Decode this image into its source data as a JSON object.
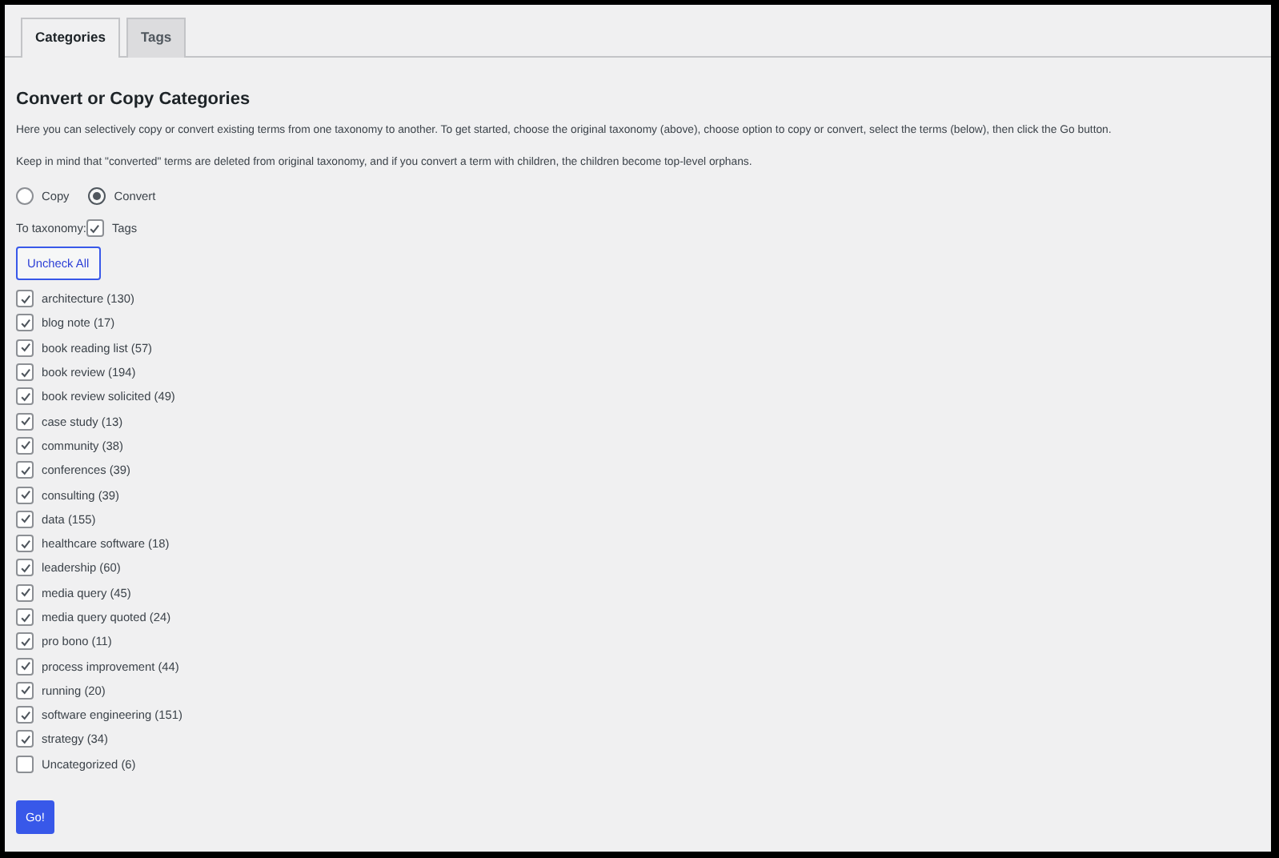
{
  "tabs": [
    {
      "label": "Categories",
      "selected": true
    },
    {
      "label": "Tags",
      "selected": false
    }
  ],
  "heading": "Convert or Copy Categories",
  "paragraphs": [
    "Here you can selectively copy or convert existing terms from one taxonomy to another. To get started, choose the original taxonomy (above), choose option to copy or convert, select the terms (below), then click the Go button.",
    "Keep in mind that \"converted\" terms are deleted from original taxonomy, and if you convert a term with children, the children become top-level orphans."
  ],
  "mode_options": [
    {
      "label": "Copy",
      "selected": false
    },
    {
      "label": "Convert",
      "selected": true
    }
  ],
  "to_taxonomy": {
    "label": "To taxonomy:",
    "options": [
      {
        "label": "Tags",
        "checked": true
      }
    ]
  },
  "uncheck_all_button": "Uncheck All",
  "terms": [
    {
      "label": "architecture (130)",
      "checked": true
    },
    {
      "label": "blog note (17)",
      "checked": true
    },
    {
      "label": "book reading list (57)",
      "checked": true
    },
    {
      "label": "book review (194)",
      "checked": true
    },
    {
      "label": "book review solicited (49)",
      "checked": true
    },
    {
      "label": "case study (13)",
      "checked": true
    },
    {
      "label": "community (38)",
      "checked": true
    },
    {
      "label": "conferences (39)",
      "checked": true
    },
    {
      "label": "consulting (39)",
      "checked": true
    },
    {
      "label": "data (155)",
      "checked": true
    },
    {
      "label": "healthcare software (18)",
      "checked": true
    },
    {
      "label": "leadership (60)",
      "checked": true
    },
    {
      "label": "media query (45)",
      "checked": true
    },
    {
      "label": "media query quoted (24)",
      "checked": true
    },
    {
      "label": "pro bono (11)",
      "checked": true
    },
    {
      "label": "process improvement (44)",
      "checked": true
    },
    {
      "label": "running (20)",
      "checked": true
    },
    {
      "label": "software engineering (151)",
      "checked": true
    },
    {
      "label": "strategy (34)",
      "checked": true
    },
    {
      "label": "Uncategorized (6)",
      "checked": false
    }
  ],
  "go_button": "Go!"
}
